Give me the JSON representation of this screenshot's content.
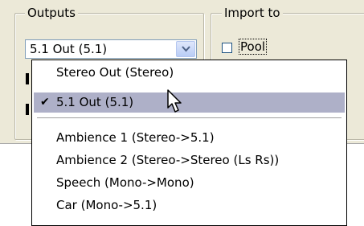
{
  "outputs_group": {
    "label": "Outputs",
    "combo_value": "5.1 Out (5.1)",
    "combo_button_icon": "chevron-down-icon"
  },
  "import_group": {
    "label": "Import to",
    "pool_label": "Pool",
    "pool_checked": false
  },
  "menu": {
    "items_top": [
      {
        "label": "Stereo Out (Stereo)",
        "checked": false,
        "selected": false
      },
      {
        "label": "5.1 Out (5.1)",
        "checked": true,
        "selected": true
      }
    ],
    "items_bottom": [
      {
        "label": "Ambience 1 (Stereo->5.1)"
      },
      {
        "label": "Ambience 2 (Stereo->Stereo (Ls Rs))"
      },
      {
        "label": "Speech (Mono->Mono)"
      },
      {
        "label": "Car (Mono->5.1)"
      }
    ],
    "check_glyph": "✔"
  },
  "colors": {
    "panel_bg": "#ece9d8",
    "selection_bg": "#aeb0c8",
    "combo_border": "#7f9db9"
  }
}
